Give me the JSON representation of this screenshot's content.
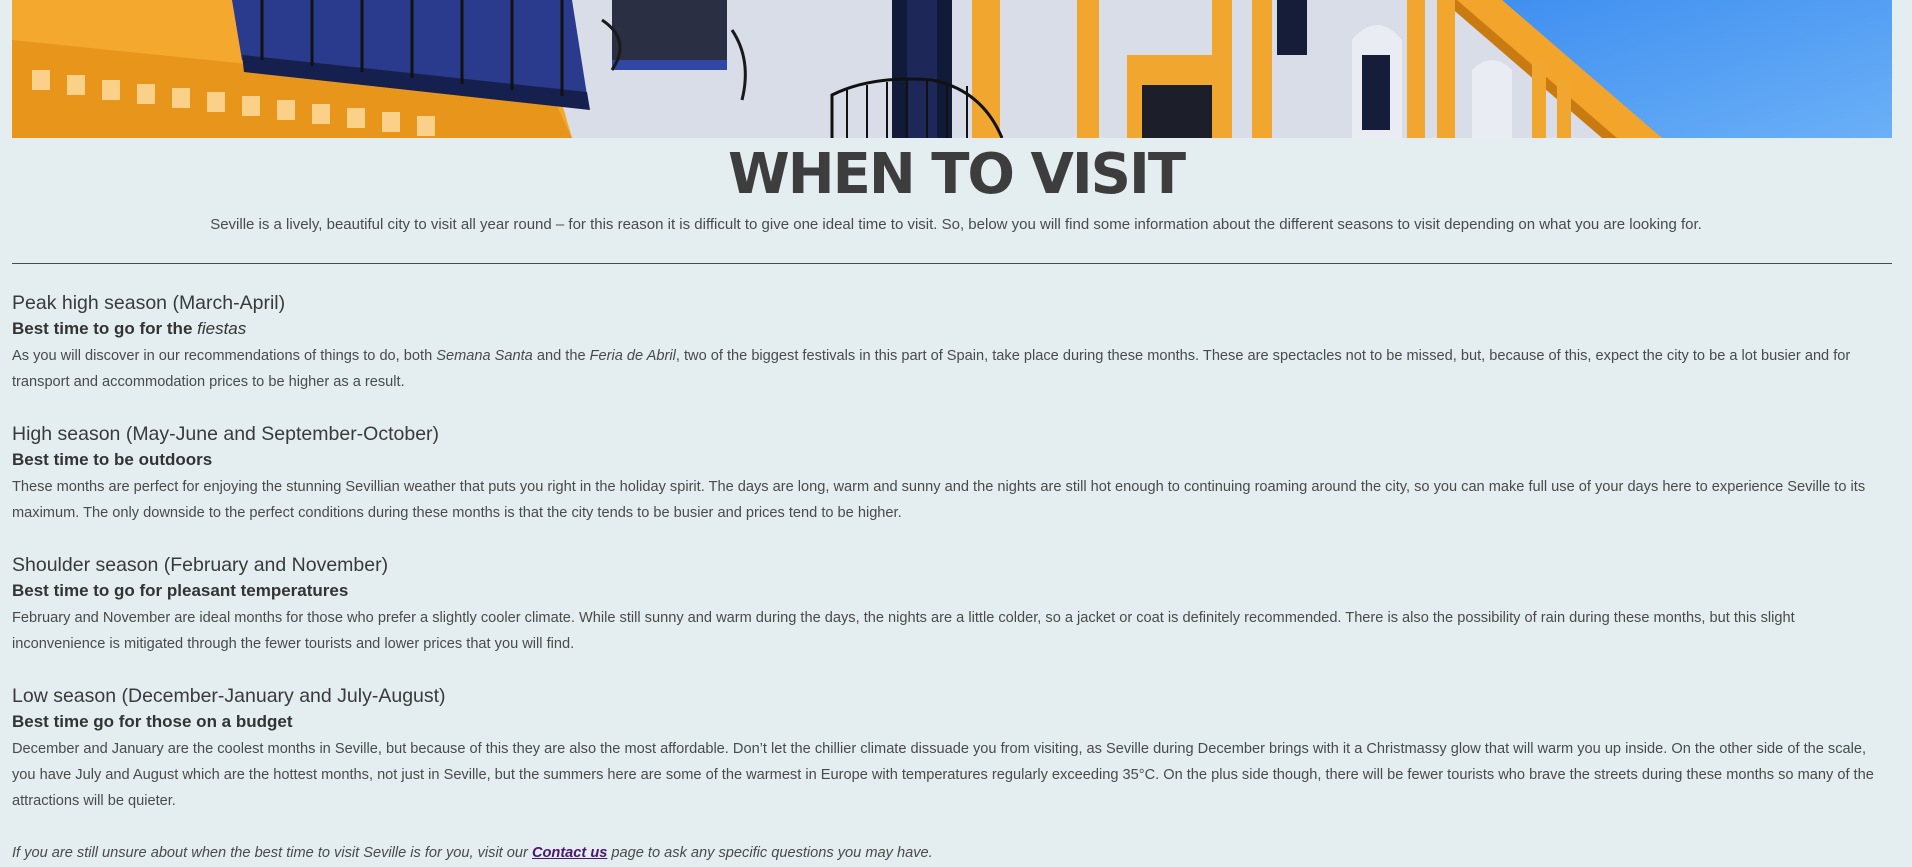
{
  "page": {
    "title": "WHEN TO VISIT",
    "intro": "Seville is a lively, beautiful city to visit all year round – for this reason it is difficult to give one ideal time to visit. So, below you will find some information about the different seasons to visit depending on what you are looking for."
  },
  "seasons": [
    {
      "heading": "Peak high season (March-April)",
      "sub_prefix": "Best time to go for the ",
      "sub_em": "fiestas",
      "text_parts": [
        {
          "t": "As you will discover in our recommendations of things to do, both ",
          "em": false
        },
        {
          "t": "Semana Santa",
          "em": true
        },
        {
          "t": " and the ",
          "em": false
        },
        {
          "t": "Feria de Abril",
          "em": true
        },
        {
          "t": ", two of the biggest festivals in this part of Spain, take place during these months. These are spectacles not to be missed, but, because of this, expect the city to be a lot busier and for transport and accommodation prices to be higher as a result.",
          "em": false
        }
      ]
    },
    {
      "heading": "High season (May-June and September-October)",
      "sub_prefix": "Best time to be outdoors",
      "sub_em": "",
      "text_parts": [
        {
          "t": "These months are perfect for enjoying the stunning Sevillian weather that puts you right in the holiday spirit. The days are long, warm and sunny and the nights are still hot enough to continuing roaming around the city, so you can make full use of your days here to experience Seville to its maximum. The only downside to the perfect conditions during these months is that the city tends to be busier and prices tend to be higher.",
          "em": false
        }
      ]
    },
    {
      "heading": "Shoulder season (February and November)",
      "sub_prefix": "Best time to go for pleasant temperatures",
      "sub_em": "",
      "text_parts": [
        {
          "t": "February and November are ideal months for those who prefer a slightly cooler climate. While still sunny and warm during the days, the nights are a little colder, so a jacket or coat is definitely recommended. There is also the possibility of rain during these months, but this slight inconvenience is mitigated through the fewer tourists and lower prices that you will find.",
          "em": false
        }
      ]
    },
    {
      "heading": "Low season (December-January and July-August)",
      "sub_prefix": "Best time go for those on a budget",
      "sub_em": "",
      "text_parts": [
        {
          "t": "December and January are the coolest months in Seville, but because of this they are also the most affordable. Don’t let the chillier climate dissuade you from visiting, as Seville during December brings with it a Christmassy glow that will warm you up inside. On the other side of the scale, you have July and August which are the hottest months, not just in Seville, but the summers here are some of the warmest in Europe with temperatures regularly exceeding 35°C. On the plus side though, there will be fewer tourists who brave the streets during these months so many of the attractions will be quieter.",
          "em": false
        }
      ]
    }
  ],
  "footer": {
    "before": "If you are still unsure about when the best time to visit Seville is for you, visit our ",
    "link_label": "Contact us",
    "after": " page to ask any specific questions you may have."
  },
  "colors": {
    "background": "#e4eef0",
    "text": "#3d3d3d",
    "link": "#4b1772",
    "facade_yellow": "#f2a52a",
    "sky_blue": "#5aa0ee"
  }
}
